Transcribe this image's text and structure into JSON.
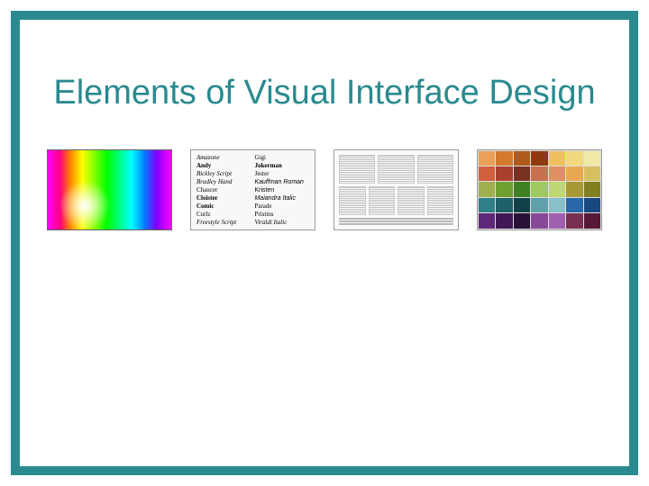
{
  "title": "Elements of Visual Interface Design",
  "thumbnails": {
    "fonts": [
      "Amazone",
      "Gigi",
      "Andy",
      "Jokerman",
      "Bickley Script",
      "Jester",
      "Bradley Hand",
      "Kauffman Roman",
      "Chaucer",
      "Kristen",
      "Cloister",
      "Maiandra Italic",
      "Comic",
      "Parade",
      "Curlz",
      "Pristins",
      "Freestyle Script",
      "Viraldi Italic"
    ],
    "tile_colors": [
      "#e8a05a",
      "#d47a2e",
      "#b05a1e",
      "#8c3a10",
      "#f0c060",
      "#f4d880",
      "#f0e8a8",
      "#d06040",
      "#a84030",
      "#783020",
      "#c87050",
      "#e09060",
      "#e8a850",
      "#d8c060",
      "#a0b050",
      "#70a030",
      "#408020",
      "#a0c860",
      "#c0d870",
      "#a89838",
      "#808020",
      "#308088",
      "#206068",
      "#104048",
      "#60a0a8",
      "#88c0c8",
      "#2868a8",
      "#184880",
      "#602878",
      "#401858",
      "#281038",
      "#884898",
      "#a060b0",
      "#783050",
      "#581838"
    ]
  }
}
